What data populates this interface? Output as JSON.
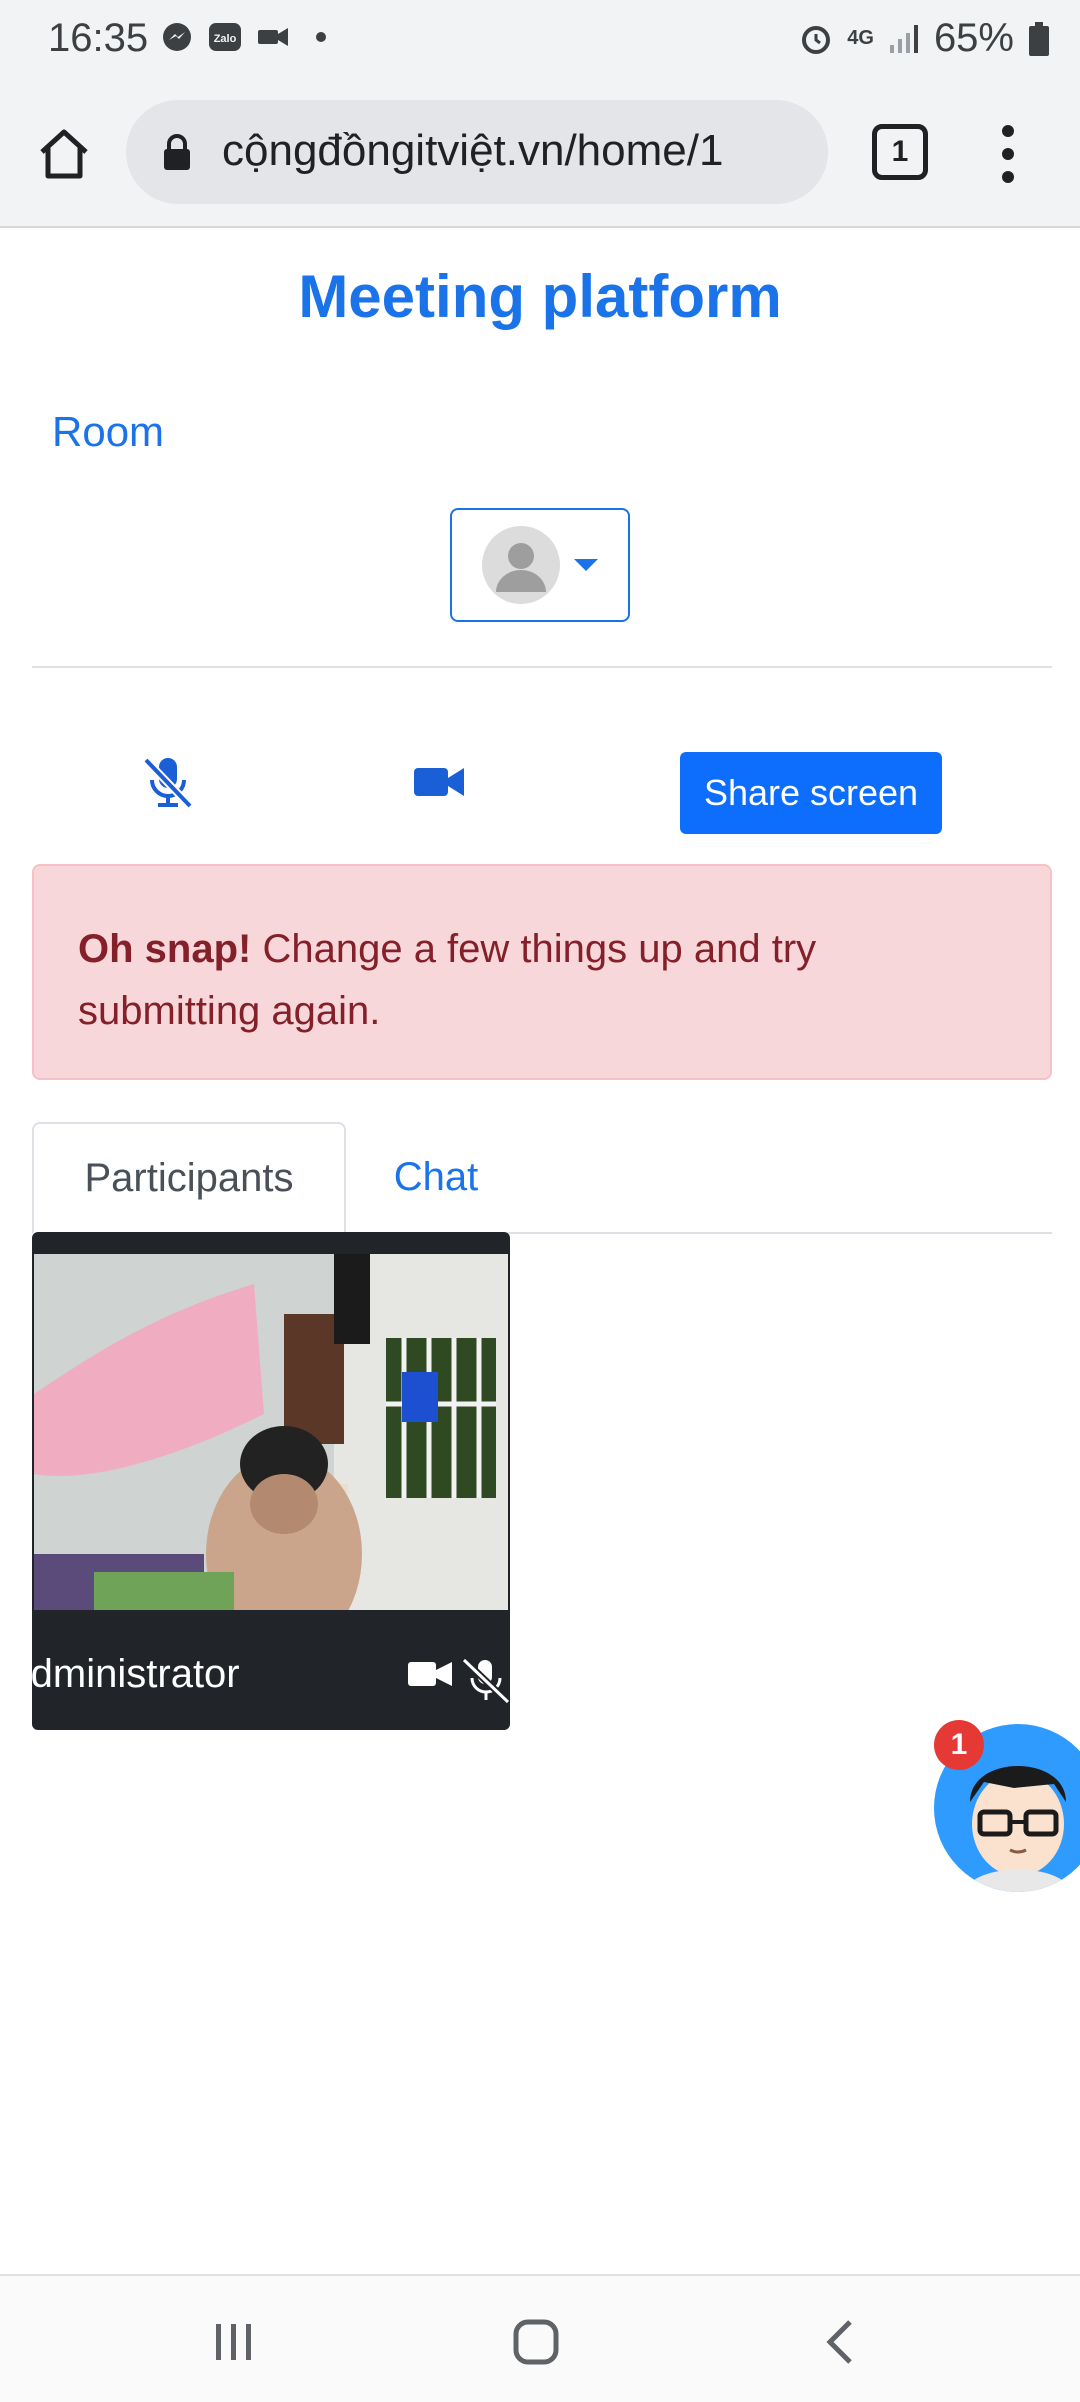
{
  "status_bar": {
    "time": "16:35",
    "battery": "65%",
    "network": "4G"
  },
  "browser": {
    "url": "cộngđồngitviệt.vn/home/1",
    "tab_count": "1"
  },
  "page": {
    "title": "Meeting platform",
    "room_link": "Room",
    "share_screen": "Share screen",
    "alert_bold": "Oh snap!",
    "alert_text": " Change a few things up and try submitting again.",
    "tabs": [
      "Participants",
      "Chat"
    ],
    "participant_name": "Administrator",
    "chat_badge": "1"
  },
  "colors": {
    "accent": "#1a73e8",
    "primary_button": "#0d6efd",
    "alert_bg": "#f8d7da",
    "alert_text": "#842029"
  },
  "icons": [
    "home-icon",
    "lock-icon",
    "menu-dots-icon",
    "mic-muted-icon",
    "video-camera-icon",
    "avatar-icon"
  ]
}
